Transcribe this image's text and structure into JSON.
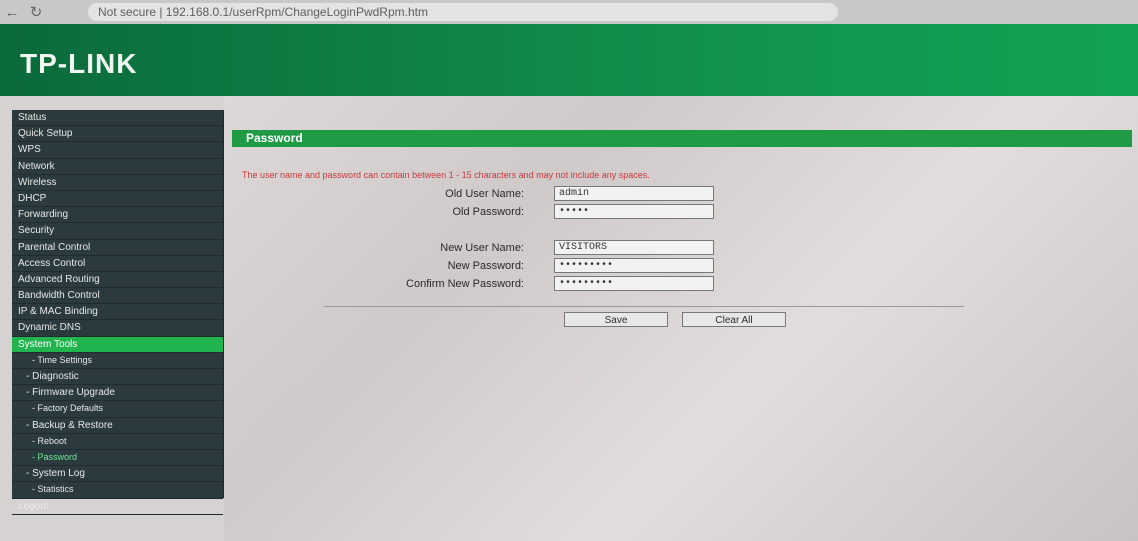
{
  "browser": {
    "address": "Not secure | 192.168.0.1/userRpm/ChangeLoginPwdRpm.htm"
  },
  "brand": {
    "logo": "TP-LINK"
  },
  "sidebar": {
    "items": [
      {
        "label": "Status"
      },
      {
        "label": "Quick Setup"
      },
      {
        "label": "WPS"
      },
      {
        "label": "Network"
      },
      {
        "label": "Wireless"
      },
      {
        "label": "DHCP"
      },
      {
        "label": "Forwarding"
      },
      {
        "label": "Security"
      },
      {
        "label": "Parental Control"
      },
      {
        "label": "Access Control"
      },
      {
        "label": "Advanced Routing"
      },
      {
        "label": "Bandwidth Control"
      },
      {
        "label": "IP & MAC Binding"
      },
      {
        "label": "Dynamic DNS"
      },
      {
        "label": "System Tools"
      },
      {
        "label": "- Time Settings"
      },
      {
        "label": "- Diagnostic"
      },
      {
        "label": "- Firmware Upgrade"
      },
      {
        "label": "- Factory Defaults"
      },
      {
        "label": "- Backup & Restore"
      },
      {
        "label": "- Reboot"
      },
      {
        "label": "- Password"
      },
      {
        "label": "- System Log"
      },
      {
        "label": "- Statistics"
      },
      {
        "label": "Logout"
      }
    ]
  },
  "page": {
    "section_title": "Password",
    "warning": "The user name and password can contain between 1 - 15 characters and may not include any spaces.",
    "fields": {
      "old_user_label": "Old User Name:",
      "old_user_value": "admin",
      "old_password_label": "Old Password:",
      "old_password_value": "•••••",
      "new_user_label": "New User Name:",
      "new_user_value": "VISITORS",
      "new_password_label": "New Password:",
      "new_password_value": "•••••••••",
      "confirm_password_label": "Confirm New Password:",
      "confirm_password_value": "•••••••••"
    },
    "buttons": {
      "save": "Save",
      "clear_all": "Clear All"
    }
  },
  "colors": {
    "header_green": "#0f8447",
    "sidebar_bg": "#2a3a3f",
    "sidebar_active": "#22b54f",
    "warning_red": "#c83a3a"
  }
}
